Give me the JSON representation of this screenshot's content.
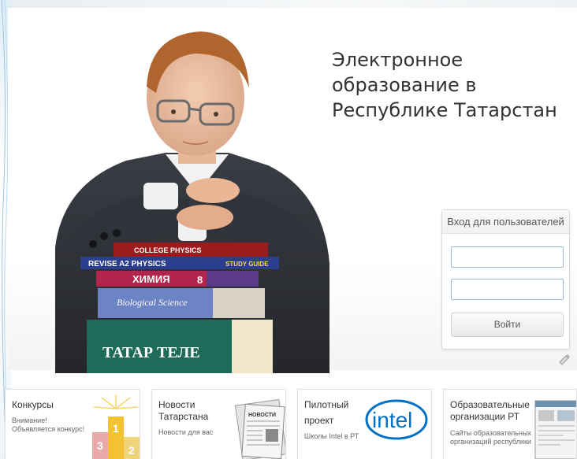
{
  "hero": {
    "title_lines": [
      "Электронное",
      "образование в",
      "Республике Татарстан"
    ]
  },
  "books": {
    "b1": "COLLEGE PHYSICS",
    "b2": "REVISE A2 PHYSICS",
    "b2b": "STUDY GUIDE",
    "b3": "ХИМИЯ",
    "b3n": "8",
    "b4": "Biological Science",
    "b5": "ТАТАР ТЕЛЕ"
  },
  "login": {
    "title": "Вход для пользователей",
    "username_value": "",
    "password_value": "",
    "button_label": "Войти"
  },
  "cards": [
    {
      "title": "Конкурсы",
      "sub1": "Внимание!",
      "sub2": "Объявляется конкурс!"
    },
    {
      "title": "Новости",
      "title2": "Татарстана",
      "sub1": "Новости для вас"
    },
    {
      "title": "Пилотный",
      "title2": "проект",
      "sub1": "Школы Intel в РТ",
      "logo": "intel"
    },
    {
      "title": "Образовательные",
      "title2": "организации РТ",
      "sub1": "Сайты образовательных",
      "sub2": "организаций республики"
    }
  ],
  "podium": {
    "p1": "1",
    "p2": "2",
    "p3": "3"
  },
  "newspaper": {
    "masthead": "НОВОСТИ"
  },
  "colors": {
    "intel_blue": "#0071c5",
    "gold": "#f2c233",
    "book_teal": "#1f6b5a",
    "link_blue": "#9fb7cc"
  }
}
